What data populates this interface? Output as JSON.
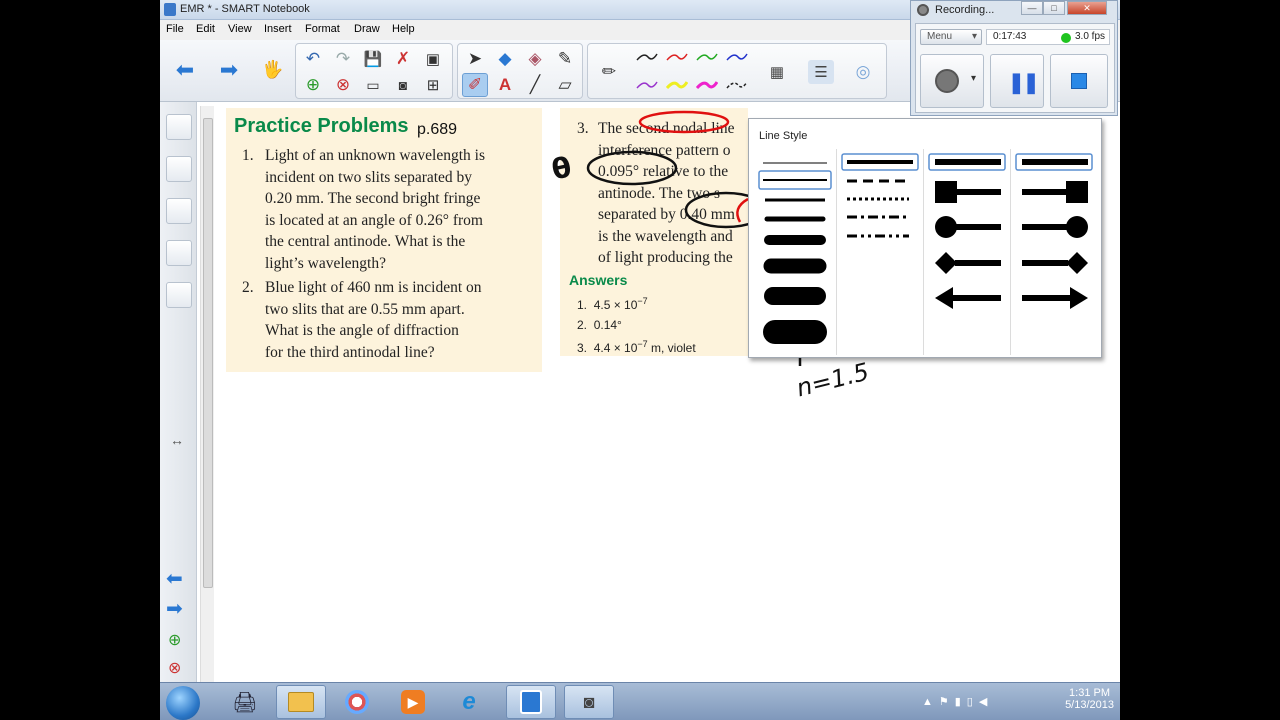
{
  "window": {
    "title": "EMR * - SMART Notebook"
  },
  "menu": [
    "File",
    "Edit",
    "View",
    "Insert",
    "Format",
    "Draw",
    "Help"
  ],
  "toolbar": {
    "icons": [
      "back-arrow",
      "forward-arrow",
      "device",
      "undo",
      "redo",
      "save",
      "clear",
      "capture",
      "add-page",
      "delete-page",
      "screen-shade",
      "document-camera",
      "table",
      "select",
      "fill",
      "eraser-shape",
      "magic-pen",
      "pens",
      "text",
      "line",
      "eraser",
      "pen",
      "line-style",
      "properties",
      "color-palette"
    ]
  },
  "recorder": {
    "title": "Recording...",
    "menu_label": "Menu",
    "elapsed": "0:17:43",
    "fps": "3.0 fps"
  },
  "page": {
    "heading": "Practice Problems",
    "page_ref": "p.689",
    "problems_left": [
      {
        "num": "1.",
        "lines": [
          "Light of an unknown wavelength is",
          "incident on two slits separated by",
          "0.20 mm. The second bright fringe",
          "is located at an angle of 0.26° from",
          "the central antinode. What is the",
          "light’s wavelength?"
        ]
      },
      {
        "num": "2.",
        "lines": [
          "Blue light of 460 nm is incident on",
          "two slits that are 0.55 mm apart.",
          "What is the angle of diffraction",
          "for the third antinodal line?"
        ]
      }
    ],
    "problem_right": {
      "num": "3.",
      "lines": [
        [
          "The second nodal line"
        ],
        [
          "interference pattern o"
        ],
        [
          "0.095°",
          " relative to the"
        ],
        [
          "antinode. The two s"
        ],
        [
          "separated by ",
          "0.40",
          " mm"
        ],
        [
          "is the wavelength and"
        ],
        [
          "of light producing the"
        ]
      ]
    },
    "answers_heading": "Answers",
    "answers": [
      {
        "num": "1.",
        "text": "4.5 × 10",
        "sup": "−7"
      },
      {
        "num": "2.",
        "text": "0.14°",
        "sup": ""
      },
      {
        "num": "3.",
        "text": "4.4 × 10",
        "sup": "−7",
        "tail": " m, violet"
      }
    ],
    "handwriting": {
      "theta": "θ",
      "n_value": "n=1.5"
    }
  },
  "line_style_popup": {
    "title": "Line Style",
    "thickness_options": 7,
    "dash_options": [
      "dash",
      "dot",
      "dash-dot",
      "dash-dot-dot"
    ],
    "start_caps": [
      "square",
      "round",
      "diamond",
      "arrow"
    ],
    "end_caps": [
      "square",
      "round",
      "diamond",
      "arrow"
    ]
  },
  "taskbar": {
    "apps": [
      "printer-app",
      "file-explorer",
      "paint-app",
      "media-player",
      "internet-explorer",
      "smart-notebook",
      "document-camera-app"
    ],
    "time": "1:31 PM",
    "date": "5/13/2013"
  },
  "colors": {
    "heading_green": "#0a8a4a",
    "card_bg": "#fdf3dc",
    "annotation_red": "#e01010",
    "annotation_black": "#111111"
  }
}
